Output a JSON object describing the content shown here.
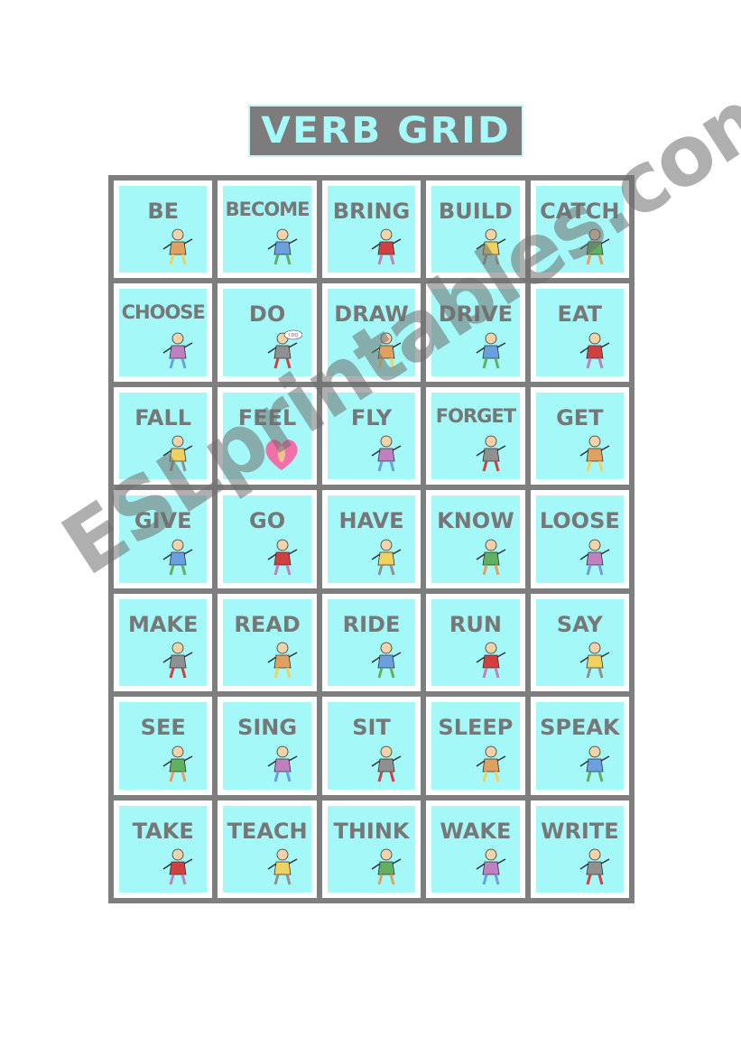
{
  "title": "VERB GRID",
  "colors": {
    "card": "#a4f8f8",
    "grid": "#7e7e7e",
    "text": "#777777"
  },
  "verbs": [
    {
      "word": "BE",
      "icon": "cartoon-baby-icon"
    },
    {
      "word": "BECOME",
      "icon": "cartoon-man-icon"
    },
    {
      "word": "BRING",
      "icon": "cartoon-man-carrying-icon"
    },
    {
      "word": "BUILD",
      "icon": "cartoon-builder-icon"
    },
    {
      "word": "CATCH",
      "icon": "cartoon-catch-icon"
    },
    {
      "word": "CHOOSE",
      "icon": "cartoon-choose-icon"
    },
    {
      "word": "DO",
      "icon": "cartoon-i-do-icon",
      "bubble": "I DO"
    },
    {
      "word": "DRAW",
      "icon": "cartoon-draw-icon"
    },
    {
      "word": "DRIVE",
      "icon": "cartoon-car-icon"
    },
    {
      "word": "EAT",
      "icon": "cartoon-eat-icon"
    },
    {
      "word": "FALL",
      "icon": "cartoon-fall-icon"
    },
    {
      "word": "FEEL",
      "icon": "heart-icon"
    },
    {
      "word": "FLY",
      "icon": "cartoon-fly-icon"
    },
    {
      "word": "FORGET",
      "icon": "cartoon-forget-icon"
    },
    {
      "word": "GET",
      "icon": "cartoon-get-icon"
    },
    {
      "word": "GIVE",
      "icon": "cartoon-flower-icon"
    },
    {
      "word": "GO",
      "icon": "cartoon-walk-icon"
    },
    {
      "word": "HAVE",
      "icon": "cartoon-have-icon"
    },
    {
      "word": "KNOW",
      "icon": "cartoon-know-icon"
    },
    {
      "word": "LOOSE",
      "icon": "cartoon-loose-icon"
    },
    {
      "word": "MAKE",
      "icon": "cartoon-make-icon"
    },
    {
      "word": "READ",
      "icon": "cartoon-read-icon"
    },
    {
      "word": "RIDE",
      "icon": "cartoon-ride-icon"
    },
    {
      "word": "RUN",
      "icon": "cartoon-run-icon"
    },
    {
      "word": "SAY",
      "icon": "cartoon-say-icon"
    },
    {
      "word": "SEE",
      "icon": "cartoon-binoculars-icon"
    },
    {
      "word": "SING",
      "icon": "cartoon-sing-icon"
    },
    {
      "word": "SIT",
      "icon": "cartoon-sit-icon"
    },
    {
      "word": "SLEEP",
      "icon": "cartoon-sleep-icon"
    },
    {
      "word": "SPEAK",
      "icon": "cartoon-speak-icon"
    },
    {
      "word": "TAKE",
      "icon": "cartoon-take-icon"
    },
    {
      "word": "TEACH",
      "icon": "cartoon-blackboard-icon"
    },
    {
      "word": "THINK",
      "icon": "cartoon-think-icon"
    },
    {
      "word": "WAKE",
      "icon": "cartoon-wake-icon"
    },
    {
      "word": "WRITE",
      "icon": "cartoon-pen-icon"
    }
  ],
  "watermark": "ESLprintables.com"
}
